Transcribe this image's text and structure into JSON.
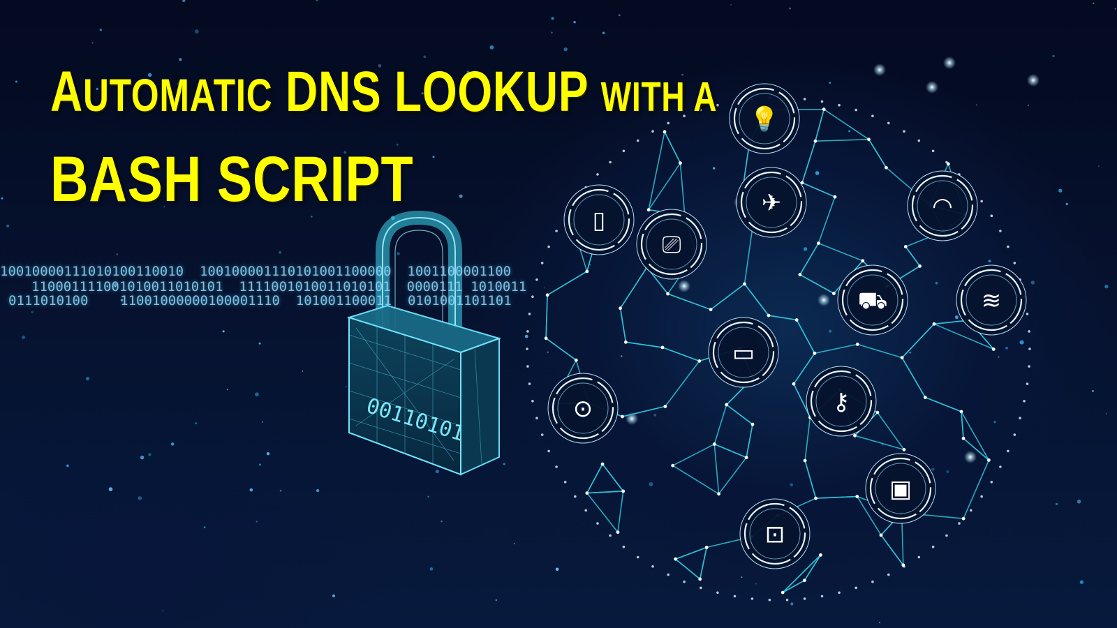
{
  "title": {
    "line1": {
      "w1_initial": "A",
      "w1_rest": "UTOMATIC",
      "w2": "DNS LOOKUP",
      "w3": "WITH A"
    },
    "line2": "BASH SCRIPT"
  },
  "binary": {
    "row1": "10010000111010100110010  100100001110101001100000  1001100001100",
    "row2": "110001111001010011010101  1111001010011010101  0000111 1010011",
    "row3": "0111010100    11001000000100001110  101001100011  0101001101101"
  },
  "lock_code": "00110101",
  "iot_icons": [
    "lamp-icon",
    "airplane-icon",
    "wifi-icon",
    "fridge-icon",
    "camera-icon",
    "car-icon",
    "air-conditioner-icon",
    "monitor-icon",
    "key-icon",
    "washing-machine-icon",
    "microwave-icon",
    "coffee-maker-icon"
  ],
  "colors": {
    "title": "#ffff00",
    "network": "#2ec6d8",
    "background": "#050b24"
  }
}
